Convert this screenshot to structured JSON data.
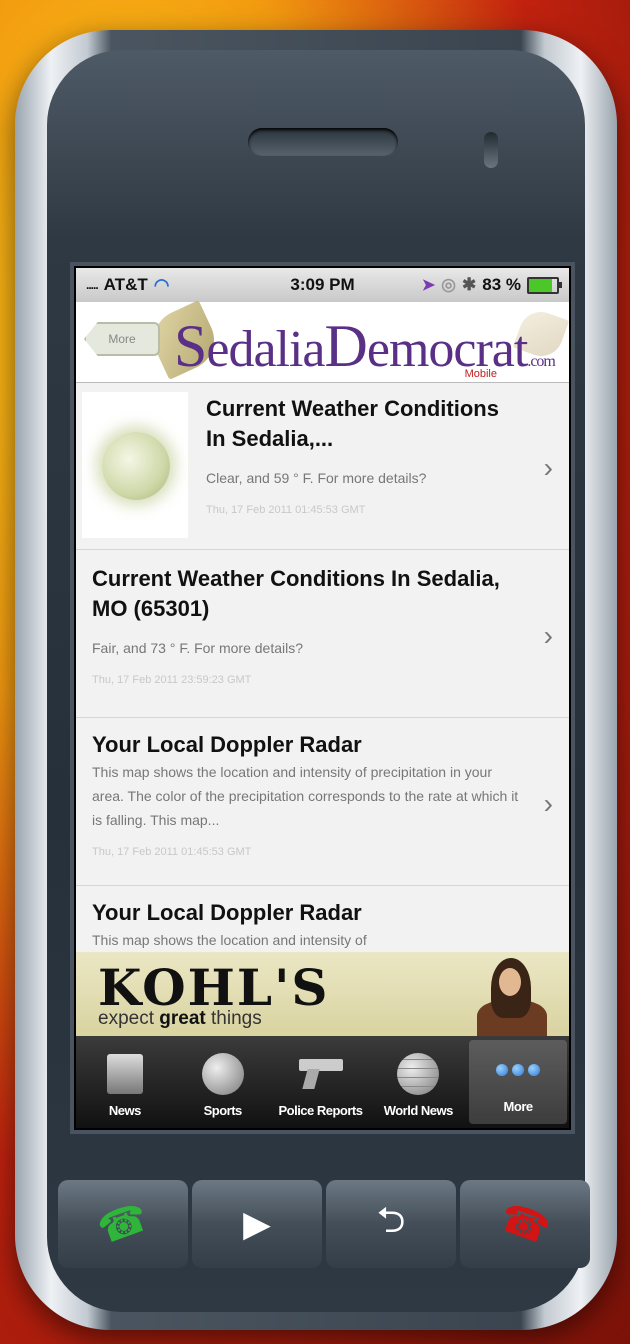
{
  "status_bar": {
    "carrier": "AT&T",
    "signal": ".....",
    "time": "3:09 PM",
    "battery_text": "83 %",
    "battery_color": "#4cc72a"
  },
  "header": {
    "back_label": "More",
    "logo_first": "S",
    "logo_middle": "edalia",
    "logo_second": "D",
    "logo_end": "emocrat",
    "logo_com": ".com",
    "logo_sub": "Mobile",
    "logo_color": "#5a2f86"
  },
  "feed": [
    {
      "title": "Current Weather Conditions In Sedalia,...",
      "desc": "Clear, and 59 ° F. For more details?",
      "date": "Thu, 17 Feb 2011 01:45:53 GMT",
      "thumbnail": "moon-image"
    },
    {
      "title": "Current Weather Conditions In Sedalia, MO (65301)",
      "desc": "Fair, and 73 ° F. For more details?",
      "date": "Thu, 17 Feb 2011 23:59:23 GMT"
    },
    {
      "title": "Your Local Doppler Radar",
      "desc": "This map shows the location and intensity of precipitation in your area. The color of the precipitation corresponds to the rate at which it is falling.  This map...",
      "date": "Thu, 17 Feb 2011 01:45:53 GMT"
    },
    {
      "title": "Your Local Doppler Radar",
      "desc": "This map shows the location and intensity of"
    }
  ],
  "ad": {
    "brand": "KOHL'S",
    "tagline_start": "expect",
    "tagline_bold": "great",
    "tagline_end": "things"
  },
  "tabs": [
    {
      "label": "News",
      "icon": "newspaper-icon"
    },
    {
      "label": "Sports",
      "icon": "basketball-icon"
    },
    {
      "label": "Police Reports",
      "icon": "handgun-icon"
    },
    {
      "label": "World News",
      "icon": "globe-icon"
    },
    {
      "label": "More",
      "icon": "more-dots-icon",
      "active": true
    }
  ],
  "hardware_buttons": {
    "call": "☎",
    "play": "▶",
    "back": "⮌",
    "end": "☎"
  }
}
